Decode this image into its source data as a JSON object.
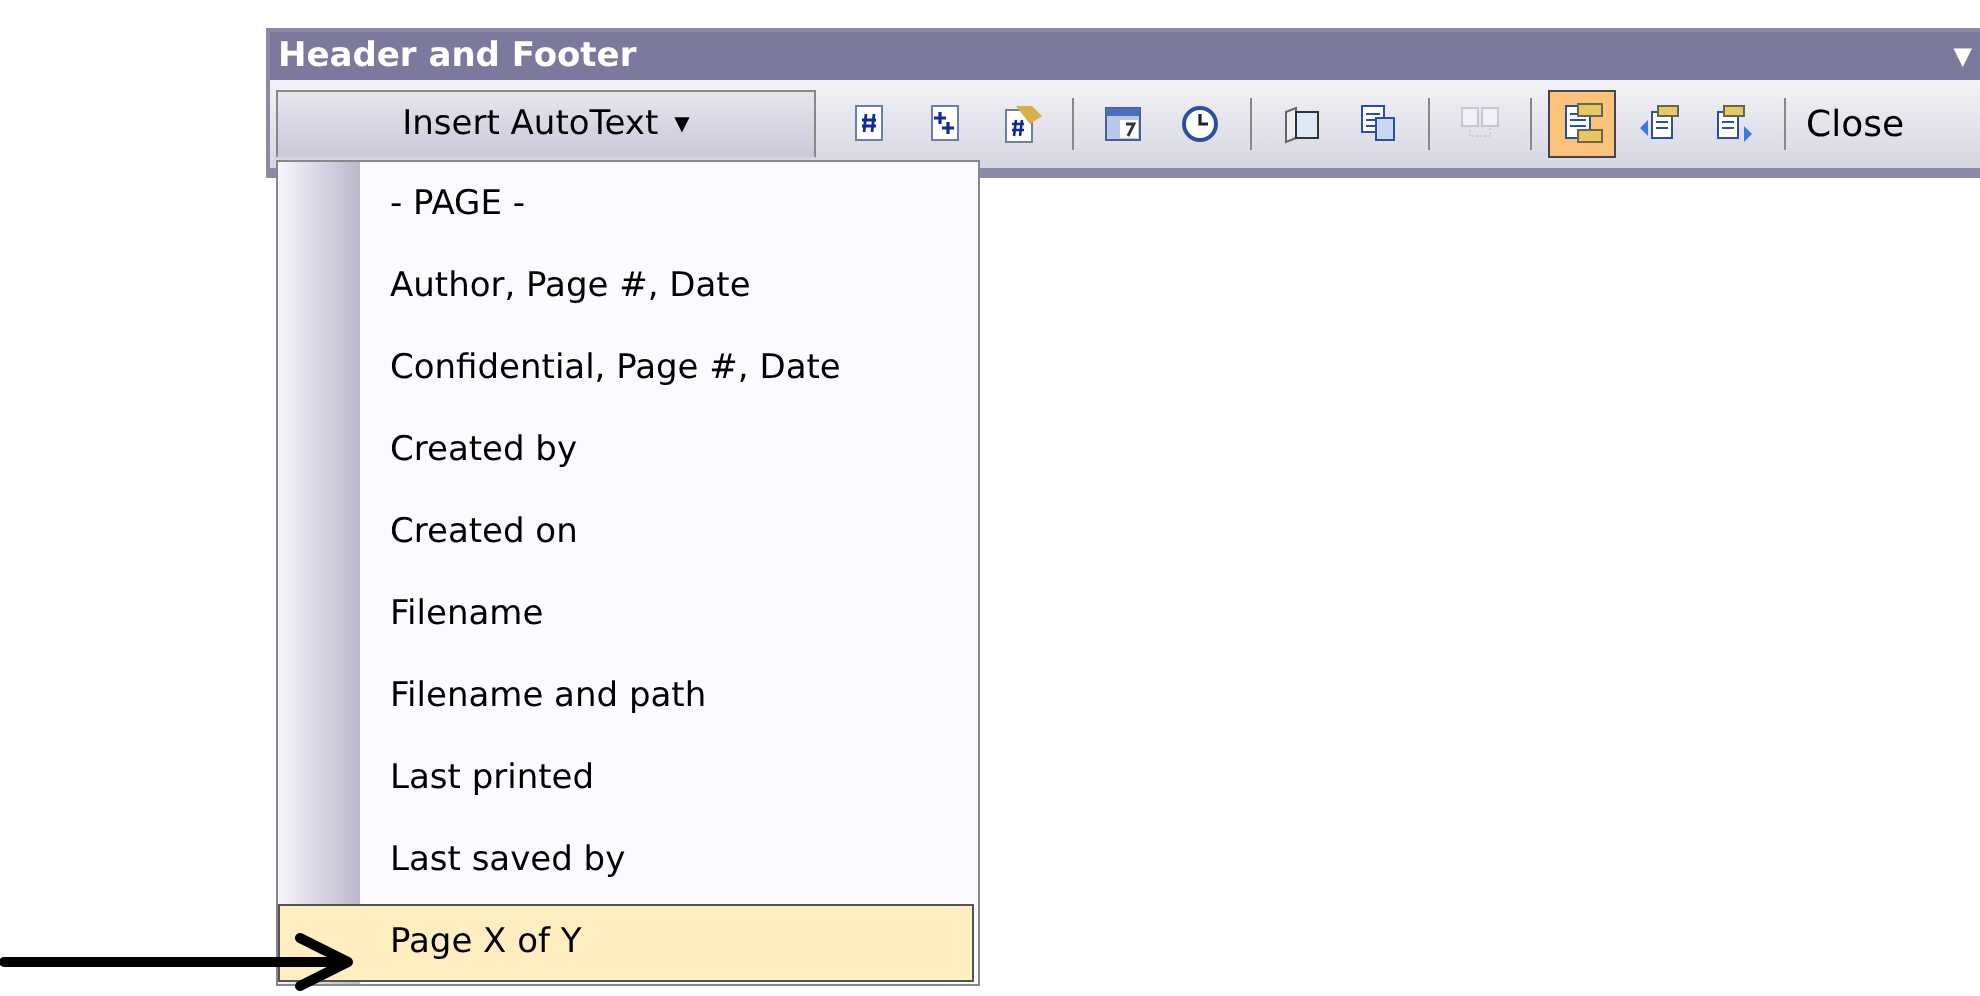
{
  "toolbar": {
    "title": "Header and Footer",
    "menu_caret": "▼",
    "autotext_button": {
      "label": "Insert AutoText",
      "caret": "▼",
      "expanded": true
    },
    "items": [
      {
        "kind": "button",
        "selected": false,
        "disabled": false
      },
      {
        "kind": "button",
        "selected": false,
        "disabled": false
      },
      {
        "kind": "button",
        "selected": false,
        "disabled": false
      },
      {
        "kind": "separator"
      },
      {
        "kind": "button",
        "selected": false,
        "disabled": false
      },
      {
        "kind": "button",
        "selected": false,
        "disabled": false
      },
      {
        "kind": "separator"
      },
      {
        "kind": "button",
        "selected": false,
        "disabled": false
      },
      {
        "kind": "button",
        "selected": false,
        "disabled": false
      },
      {
        "kind": "separator"
      },
      {
        "kind": "button",
        "selected": false,
        "disabled": true
      },
      {
        "kind": "separator"
      },
      {
        "kind": "button",
        "selected": true,
        "disabled": false
      },
      {
        "kind": "button",
        "selected": false,
        "disabled": false
      },
      {
        "kind": "button",
        "selected": false,
        "disabled": false
      },
      {
        "kind": "separator"
      },
      {
        "kind": "text",
        "label": "Close"
      }
    ]
  },
  "autotext_menu": [
    {
      "label": "- PAGE -",
      "selected": false
    },
    {
      "label": "Author, Page #, Date",
      "selected": false
    },
    {
      "label": "Confidential, Page #, Date",
      "selected": false
    },
    {
      "label": "Created by",
      "selected": false
    },
    {
      "label": "Created on",
      "selected": false
    },
    {
      "label": "Filename",
      "selected": false
    },
    {
      "label": "Filename and path",
      "selected": false
    },
    {
      "label": "Last printed",
      "selected": false
    },
    {
      "label": "Last saved by",
      "selected": false
    },
    {
      "label": "Page X of Y",
      "selected": true
    }
  ],
  "pointer_arrow": true
}
